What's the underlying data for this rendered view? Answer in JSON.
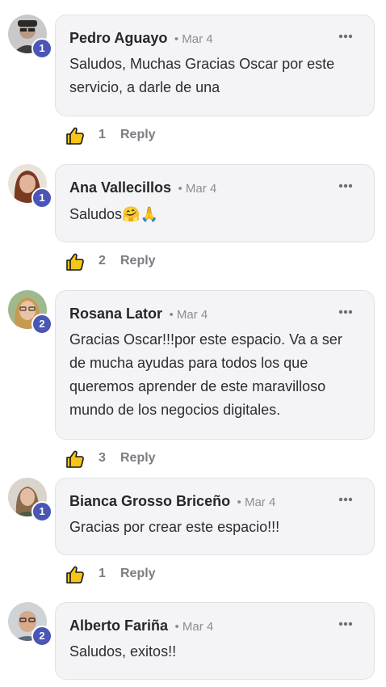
{
  "comments": [
    {
      "author": "Pedro Aguayo",
      "date": "• Mar 4",
      "level": "1",
      "body": "Saludos, Muchas Gracias Oscar por este servicio, a darle de una",
      "likes": "1",
      "reply_label": "Reply"
    },
    {
      "author": "Ana Vallecillos",
      "date": "• Mar 4",
      "level": "1",
      "body": "Saludos🤗🙏",
      "likes": "2",
      "reply_label": "Reply"
    },
    {
      "author": "Rosana Lator",
      "date": "• Mar 4",
      "level": "2",
      "body": "Gracias Oscar!!!por este espacio. Va a ser de mucha ayudas para todos los que queremos aprender de este maravilloso mundo de los negocios digitales.",
      "likes": "3",
      "reply_label": "Reply"
    },
    {
      "author": "Bianca Grosso Briceño",
      "date": "• Mar 4",
      "level": "1",
      "body": "Gracias por crear este espacio!!!",
      "likes": "1",
      "reply_label": "Reply"
    },
    {
      "author": "Alberto Fariña",
      "date": "• Mar 4",
      "level": "2",
      "body": "Saludos, exitos!!"
    }
  ],
  "icons": {
    "like": "thumbs-up-icon",
    "more": "more-options-icon"
  },
  "colors": {
    "level_badge": "#4a55b5",
    "thumb_fill": "#f5c518",
    "bubble_bg": "#f4f4f6"
  }
}
